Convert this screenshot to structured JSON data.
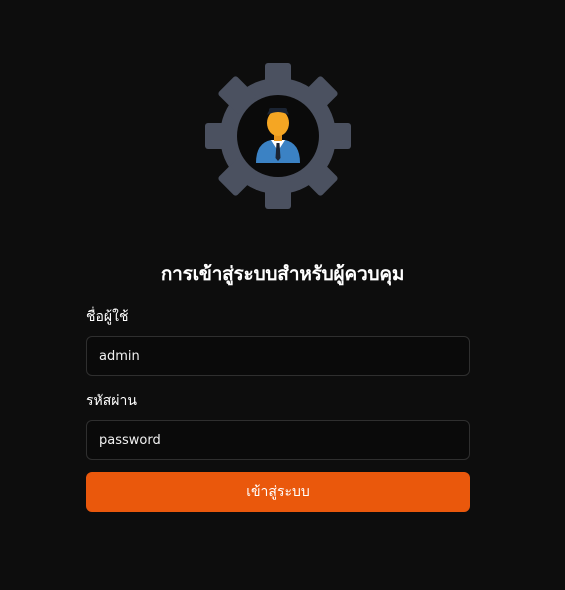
{
  "logo": {
    "icon": "gear-admin-icon",
    "gear_color": "#4b5160",
    "person_skin_color": "#f5a623",
    "person_shirt_color": "#3b82c4"
  },
  "login": {
    "title": "การเข้าสู่ระบบสำหรับผู้ควบคุม",
    "username_label": "ชื่อผู้ใช้",
    "username_value": "admin",
    "password_label": "รหัสผ่าน",
    "password_value": "password",
    "submit_label": "เข้าสู่ระบบ"
  },
  "colors": {
    "background": "#0d0d0d",
    "accent": "#ea580c",
    "input_border": "#2f2f2f"
  }
}
